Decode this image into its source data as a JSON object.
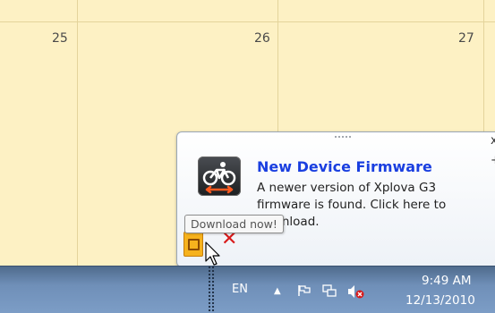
{
  "calendar": {
    "days": [
      "25",
      "26",
      "27"
    ]
  },
  "notification": {
    "title": "New Device Firmware",
    "body": "A newer version of Xplova G3 firmware is found. Click here to download.",
    "close_glyph": "x",
    "plus_glyph": "+",
    "icon": "cyclist-icon"
  },
  "tooltip": {
    "text": "Download now!"
  },
  "taskbar": {
    "language": "EN",
    "time": "9:49 AM",
    "date": "12/13/2010",
    "tray_icons": [
      "show-hidden-icons-arrow",
      "flag-icon",
      "network-icon",
      "speaker-muted-icon"
    ]
  },
  "colors": {
    "calendar_bg": "#fdf1c4",
    "title_blue": "#1a3fe0",
    "taskbar": "#6f8fb8",
    "cancel_red": "#d81a1a"
  }
}
